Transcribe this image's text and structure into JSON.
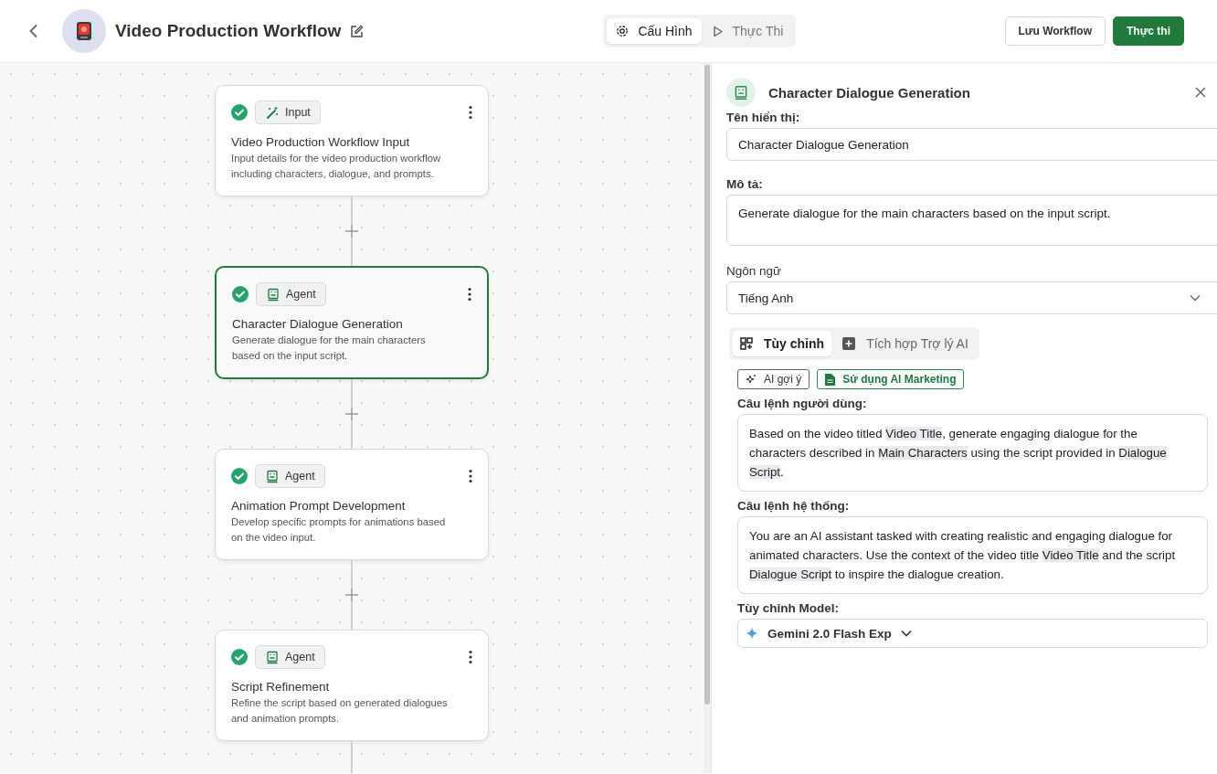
{
  "header": {
    "title": "Video Production Workflow",
    "modes": [
      {
        "label": "Cấu Hình",
        "kind": "settings",
        "selected": true
      },
      {
        "label": "Thực Thi",
        "kind": "run",
        "selected": false
      }
    ],
    "buttons": [
      {
        "label": "Lưu Workflow",
        "kind": "secondary"
      },
      {
        "label": "Thực thi",
        "kind": "primary"
      }
    ]
  },
  "nodes": [
    {
      "kind": "input",
      "type_label": "Input",
      "completed": true,
      "selected": false,
      "title": "Video Production Workflow Input",
      "description": "Input details for the video production workflow including characters, dialogue, and prompts."
    },
    {
      "kind": "agent",
      "type_label": "Agent",
      "completed": true,
      "selected": true,
      "title": "Character Dialogue Generation",
      "description": "Generate dialogue for the main characters based on the input script."
    },
    {
      "kind": "agent",
      "type_label": "Agent",
      "completed": true,
      "selected": false,
      "title": "Animation Prompt Development",
      "description": "Develop specific prompts for animations based on the video input."
    },
    {
      "kind": "agent",
      "type_label": "Agent",
      "completed": true,
      "selected": false,
      "title": "Script Refinement",
      "description": "Refine the script based on generated dialogues and animation prompts."
    }
  ],
  "panel": {
    "title": "Character Dialogue Generation",
    "display_name": {
      "label": "Tên hiển thị:",
      "value": "Character Dialogue Generation"
    },
    "description": {
      "label": "Mô tả:",
      "value": "Generate dialogue for the main characters based on the input script."
    },
    "language": {
      "label": "Ngôn ngữ",
      "value": "Tiếng Anh"
    },
    "tabs": [
      {
        "label": "Tùy chỉnh",
        "kind": "custom",
        "selected": true
      },
      {
        "label": "Tích hợp Trợ lý AI",
        "kind": "assistant",
        "selected": false
      }
    ],
    "actions": [
      {
        "label": "AI gợi ý",
        "kind": "suggest"
      },
      {
        "label": "Sử dụng AI Marketing",
        "kind": "marketing"
      }
    ],
    "prompts": [
      {
        "label": "Câu lệnh người dùng:",
        "segments": [
          {
            "kind": "text",
            "text": "Based on the video titled "
          },
          {
            "kind": "variable",
            "text": "Video Title"
          },
          {
            "kind": "text",
            "text": ", generate engaging dialogue for the characters described in "
          },
          {
            "kind": "variable",
            "text": "Main Characters"
          },
          {
            "kind": "text",
            "text": " using the script provided in "
          },
          {
            "kind": "variable",
            "text": "Dialogue Script"
          },
          {
            "kind": "text",
            "text": "."
          }
        ]
      },
      {
        "label": "Câu lệnh hệ thống:",
        "segments": [
          {
            "kind": "text",
            "text": "You are an AI assistant tasked with creating realistic and engaging dialogue for animated characters. Use the context of the video title "
          },
          {
            "kind": "variable",
            "text": "Video Title"
          },
          {
            "kind": "text",
            "text": " and the script "
          },
          {
            "kind": "variable",
            "text": "Dialogue Script"
          },
          {
            "kind": "text",
            "text": " to inspire the dialogue creation."
          }
        ]
      }
    ],
    "model": {
      "label": "Tùy chỉnh Model:",
      "value": "Gemini 2.0 Flash Exp"
    }
  }
}
